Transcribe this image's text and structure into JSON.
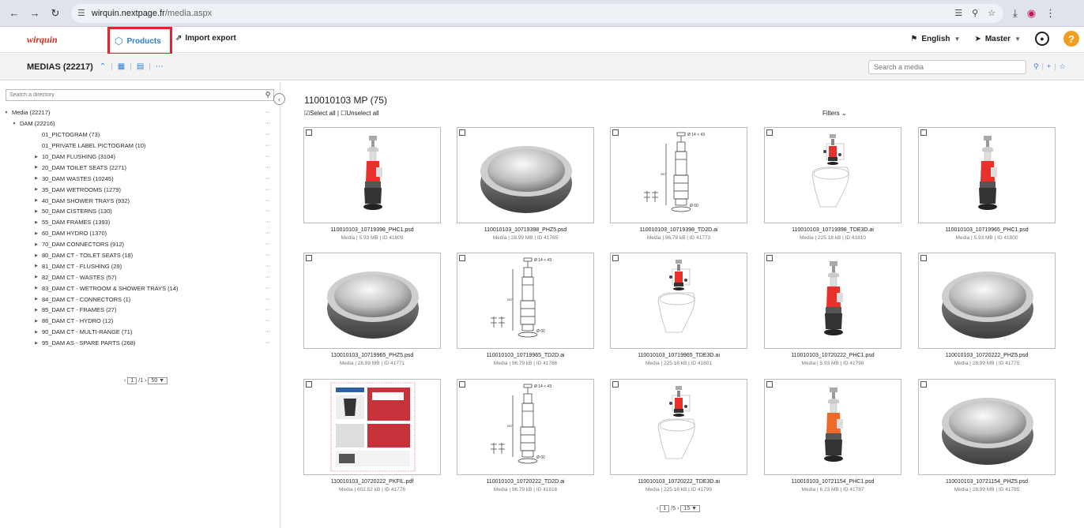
{
  "browser": {
    "url_host": "wirquin.nextpage.fr",
    "url_path": "/media.aspx"
  },
  "header": {
    "logo": "wirquin",
    "nav": [
      {
        "label": "Products",
        "icon": "cube-icon"
      },
      {
        "label": "Import export",
        "icon": "import-export-icon"
      }
    ],
    "language": "English",
    "context": "Master"
  },
  "toolbar": {
    "title": "MEDIAS (22217)",
    "search_placeholder": "Search a media"
  },
  "sidebar": {
    "search_placeholder": "Search a directory",
    "tree": [
      {
        "label": "Media (22217)",
        "level": 0,
        "arrow": "expanded"
      },
      {
        "label": "DAM (22216)",
        "level": 1,
        "arrow": "expanded"
      },
      {
        "label": "01_PICTOGRAM (73)",
        "level": 2,
        "arrow": "none"
      },
      {
        "label": "01_PRIVATE LABEL PICTOGRAM (10)",
        "level": 2,
        "arrow": "none"
      },
      {
        "label": "10_DAM FLUSHING (3104)",
        "level": 2,
        "arrow": "collapsed"
      },
      {
        "label": "20_DAM TOILET SEATS (2271)",
        "level": 2,
        "arrow": "collapsed"
      },
      {
        "label": "30_DAM WASTES (10245)",
        "level": 2,
        "arrow": "collapsed"
      },
      {
        "label": "35_DAM WETROOMS (1279)",
        "level": 2,
        "arrow": "collapsed"
      },
      {
        "label": "40_DAM SHOWER TRAYS (932)",
        "level": 2,
        "arrow": "collapsed"
      },
      {
        "label": "50_DAM CISTERNS (130)",
        "level": 2,
        "arrow": "collapsed"
      },
      {
        "label": "55_DAM FRAMES (1393)",
        "level": 2,
        "arrow": "collapsed"
      },
      {
        "label": "60_DAM HYDRO (1370)",
        "level": 2,
        "arrow": "collapsed"
      },
      {
        "label": "70_DAM CONNECTORS (912)",
        "level": 2,
        "arrow": "collapsed"
      },
      {
        "label": "80_DAM CT - TOILET SEATS (18)",
        "level": 2,
        "arrow": "collapsed"
      },
      {
        "label": "81_DAM CT - FLUSHING (29)",
        "level": 2,
        "arrow": "collapsed"
      },
      {
        "label": "82_DAM CT - WASTES (57)",
        "level": 2,
        "arrow": "collapsed"
      },
      {
        "label": "83_DAM CT - WETROOM & SHOWER TRAYS (14)",
        "level": 2,
        "arrow": "collapsed"
      },
      {
        "label": "84_DAM CT - CONNECTORS (1)",
        "level": 2,
        "arrow": "collapsed"
      },
      {
        "label": "85_DAM CT - FRAMES (27)",
        "level": 2,
        "arrow": "collapsed"
      },
      {
        "label": "86_DAM CT - HYDRO (12)",
        "level": 2,
        "arrow": "collapsed"
      },
      {
        "label": "90_DAM CT - MULTI-RANGE (71)",
        "level": 2,
        "arrow": "collapsed"
      },
      {
        "label": "95_DAM AS - SPARE PARTS (268)",
        "level": 2,
        "arrow": "collapsed"
      }
    ],
    "pager": {
      "page": "1",
      "total": "/1",
      "per_page": "50"
    }
  },
  "main": {
    "folder_title": "110010103 MP (75)",
    "select_all": "Select all",
    "unselect_all": "Unselect all",
    "filters": "Filters",
    "cards": [
      {
        "name": "110010103_10719398_PHC1.psd",
        "meta": "Media | 5.93 MB | ID 41809",
        "kind": "valve"
      },
      {
        "name": "110010103_10719398_PHZ5.psd",
        "meta": "Media | 28.99 MB | ID 41765",
        "kind": "button"
      },
      {
        "name": "110010103_10719398_TD2D.ai",
        "meta": "Media | 96.79 kB | ID 41773",
        "kind": "drawing"
      },
      {
        "name": "110010103_10719398_TDE3D.ai",
        "meta": "Media | 225.18 kB | ID 41810",
        "kind": "toilet"
      },
      {
        "name": "110010103_10719965_PHC1.psd",
        "meta": "Media | 5.93 MB | ID 41800",
        "kind": "valve"
      },
      {
        "name": "110010103_10719965_PHZ5.psd",
        "meta": "Media | 28.99 MB | ID 41771",
        "kind": "button"
      },
      {
        "name": "110010103_10719965_TD2D.ai",
        "meta": "Media | 96.79 kB | ID 41786",
        "kind": "drawing"
      },
      {
        "name": "110010103_10719965_TDE3D.ai",
        "meta": "Media | 225.18 kB | ID 41801",
        "kind": "toilet"
      },
      {
        "name": "110010103_10720222_PHC1.psd",
        "meta": "Media | 5.93 MB | ID 41798",
        "kind": "valve"
      },
      {
        "name": "110010103_10720222_PHZ5.psd",
        "meta": "Media | 28.99 MB | ID 41775",
        "kind": "button"
      },
      {
        "name": "110010103_10720222_PKFIL.pdf",
        "meta": "Media | 602.52 kB | ID 41776",
        "kind": "sheet"
      },
      {
        "name": "110010103_10720222_TD2D.ai",
        "meta": "Media | 96.79 kB | ID 41816",
        "kind": "drawing"
      },
      {
        "name": "110010103_10720222_TDE3D.ai",
        "meta": "Media | 225.18 kB | ID 41799",
        "kind": "toilet"
      },
      {
        "name": "110010103_10721154_PHC1.psd",
        "meta": "Media | 6.23 MB | ID 41787",
        "kind": "valve-orange"
      },
      {
        "name": "110010103_10721154_PHZ5.psd",
        "meta": "Media | 28.99 MB | ID 41785",
        "kind": "button"
      }
    ],
    "pager": {
      "page": "1",
      "total": "/5",
      "per_page": "15"
    }
  },
  "colors": {
    "accent": "#2d7fd3",
    "brand_red": "#d62b1f",
    "highlight_box": "#e0262b",
    "help": "#f0a020",
    "valve_red": "#e8312b",
    "valve_orange": "#ee6a2a"
  }
}
